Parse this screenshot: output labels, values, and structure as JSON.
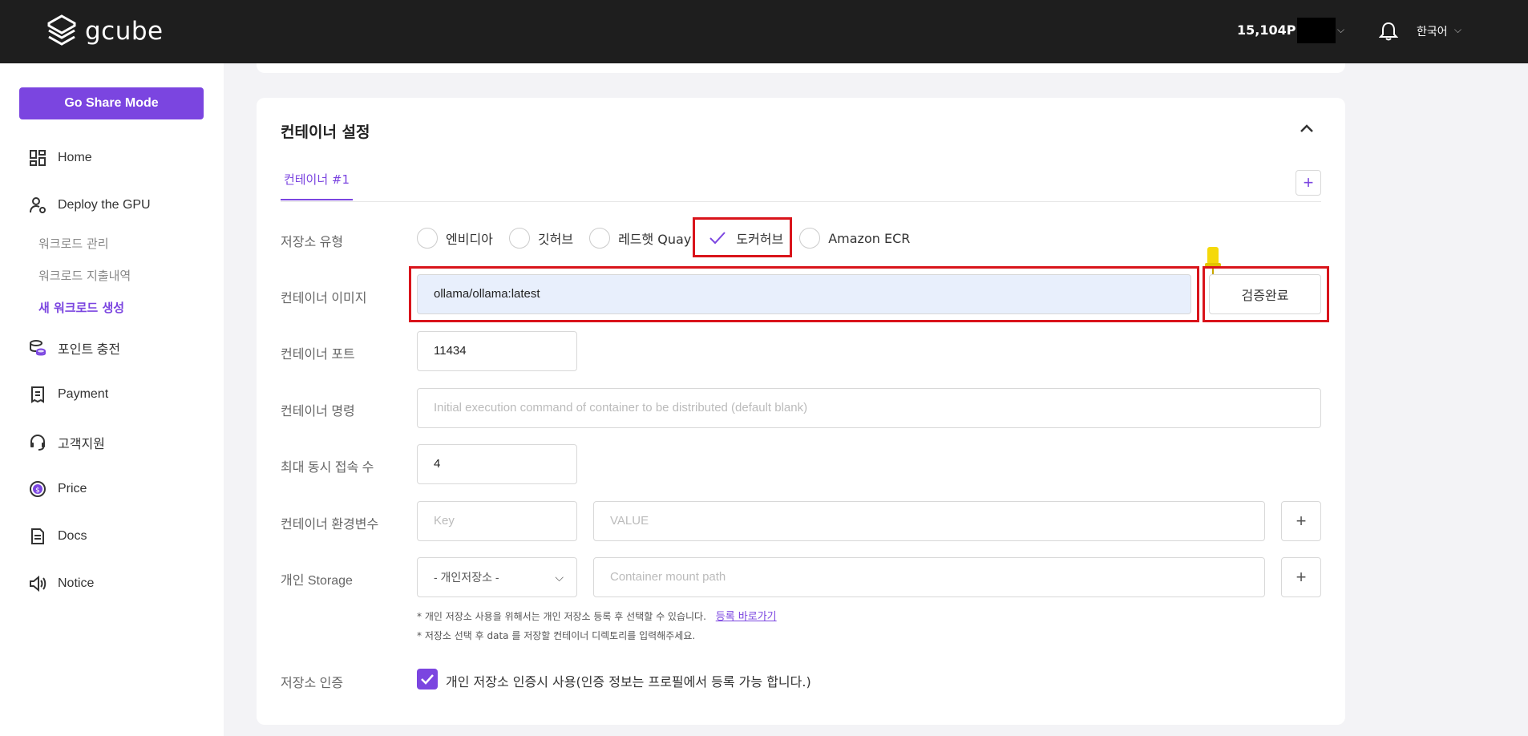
{
  "header": {
    "logo_text": "gcube",
    "points": "15,104P",
    "language": "한국어"
  },
  "sidebar": {
    "share_button": "Go Share Mode",
    "items": [
      {
        "label": "Home",
        "icon": "dashboard-icon"
      },
      {
        "label": "Deploy the GPU",
        "icon": "user-gear-icon"
      },
      {
        "label": "포인트 충전",
        "icon": "coins-icon"
      },
      {
        "label": "Payment",
        "icon": "receipt-icon"
      },
      {
        "label": "고객지원",
        "icon": "headset-icon"
      },
      {
        "label": "Price",
        "icon": "dollar-circle-icon"
      },
      {
        "label": "Docs",
        "icon": "document-icon"
      },
      {
        "label": "Notice",
        "icon": "speaker-icon"
      }
    ],
    "sub_items": [
      {
        "label": "워크로드 관리",
        "active": false
      },
      {
        "label": "워크로드 지출내역",
        "active": false
      },
      {
        "label": "새 워크로드 생성",
        "active": true
      }
    ]
  },
  "card": {
    "title": "컨테이너 설정",
    "tab_label": "컨테이너 #1",
    "add_tab_label": "+",
    "fields": {
      "storage_type_label": "저장소 유형",
      "storage_options": [
        {
          "label": "엔비디아",
          "selected": false
        },
        {
          "label": "깃허브",
          "selected": false
        },
        {
          "label": "레드햇 Quay",
          "selected": false
        },
        {
          "label": "도커허브",
          "selected": true
        },
        {
          "label": "Amazon ECR",
          "selected": false
        }
      ],
      "image_label": "컨테이너 이미지",
      "image_value": "ollama/ollama:latest",
      "verify_button": "검증완료",
      "port_label": "컨테이너 포트",
      "port_value": "11434",
      "command_label": "컨테이너 명령",
      "command_placeholder": "Initial execution command of container to be distributed (default blank)",
      "max_conn_label": "최대 동시 접속 수",
      "max_conn_value": "4",
      "env_label": "컨테이너 환경변수",
      "env_key_placeholder": "Key",
      "env_value_placeholder": "VALUE",
      "storage_label": "개인 Storage",
      "storage_select": "- 개인저장소 -",
      "mount_placeholder": "Container mount path",
      "plus": "+",
      "note1": "* 개인 저장소 사용을 위해서는 개인 저장소 등록 후 선택할 수 있습니다.",
      "note1_link": "등록 바로가기",
      "note2": "* 저장소 선택 후 data 를 저장할 컨테이너 디렉토리를 입력해주세요.",
      "auth_label": "저장소 인증",
      "auth_checkbox_label": "개인 저장소 인증시 사용(인증 정보는 프로필에서 등록 가능 합니다.)",
      "auth_checked": true
    }
  },
  "colors": {
    "accent": "#7b45e0",
    "topbar": "#1e1e1e",
    "highlight": "#d9141b"
  }
}
